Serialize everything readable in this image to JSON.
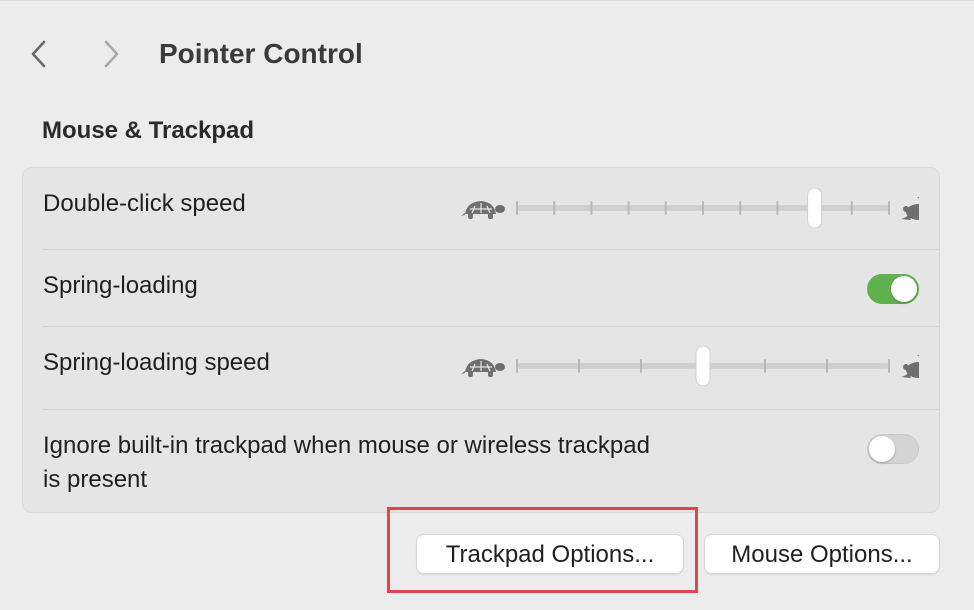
{
  "window": {
    "title": "Pointer Control"
  },
  "toolbar": {
    "back_icon": "chevron-left-icon",
    "forward_icon": "chevron-right-icon"
  },
  "section": {
    "title": "Mouse & Trackpad"
  },
  "settings": {
    "double_click_speed": {
      "label": "Double-click speed",
      "min_icon": "turtle-icon",
      "max_icon": "rabbit-icon",
      "ticks": 11,
      "value_index": 8
    },
    "spring_loading": {
      "label": "Spring-loading",
      "enabled": true
    },
    "spring_loading_speed": {
      "label": "Spring-loading speed",
      "min_icon": "turtle-icon",
      "max_icon": "rabbit-icon",
      "ticks": 7,
      "value_index": 3
    },
    "ignore_builtin_trackpad": {
      "label_line1": "Ignore built-in trackpad when mouse or wireless trackpad",
      "label_line2": "is present",
      "enabled": false
    }
  },
  "buttons": {
    "trackpad_options": "Trackpad Options...",
    "mouse_options": "Mouse Options..."
  },
  "colors": {
    "toggle_on": "#5fb24d",
    "toggle_off": "#d4d4d4",
    "highlight": "#e0474c"
  }
}
